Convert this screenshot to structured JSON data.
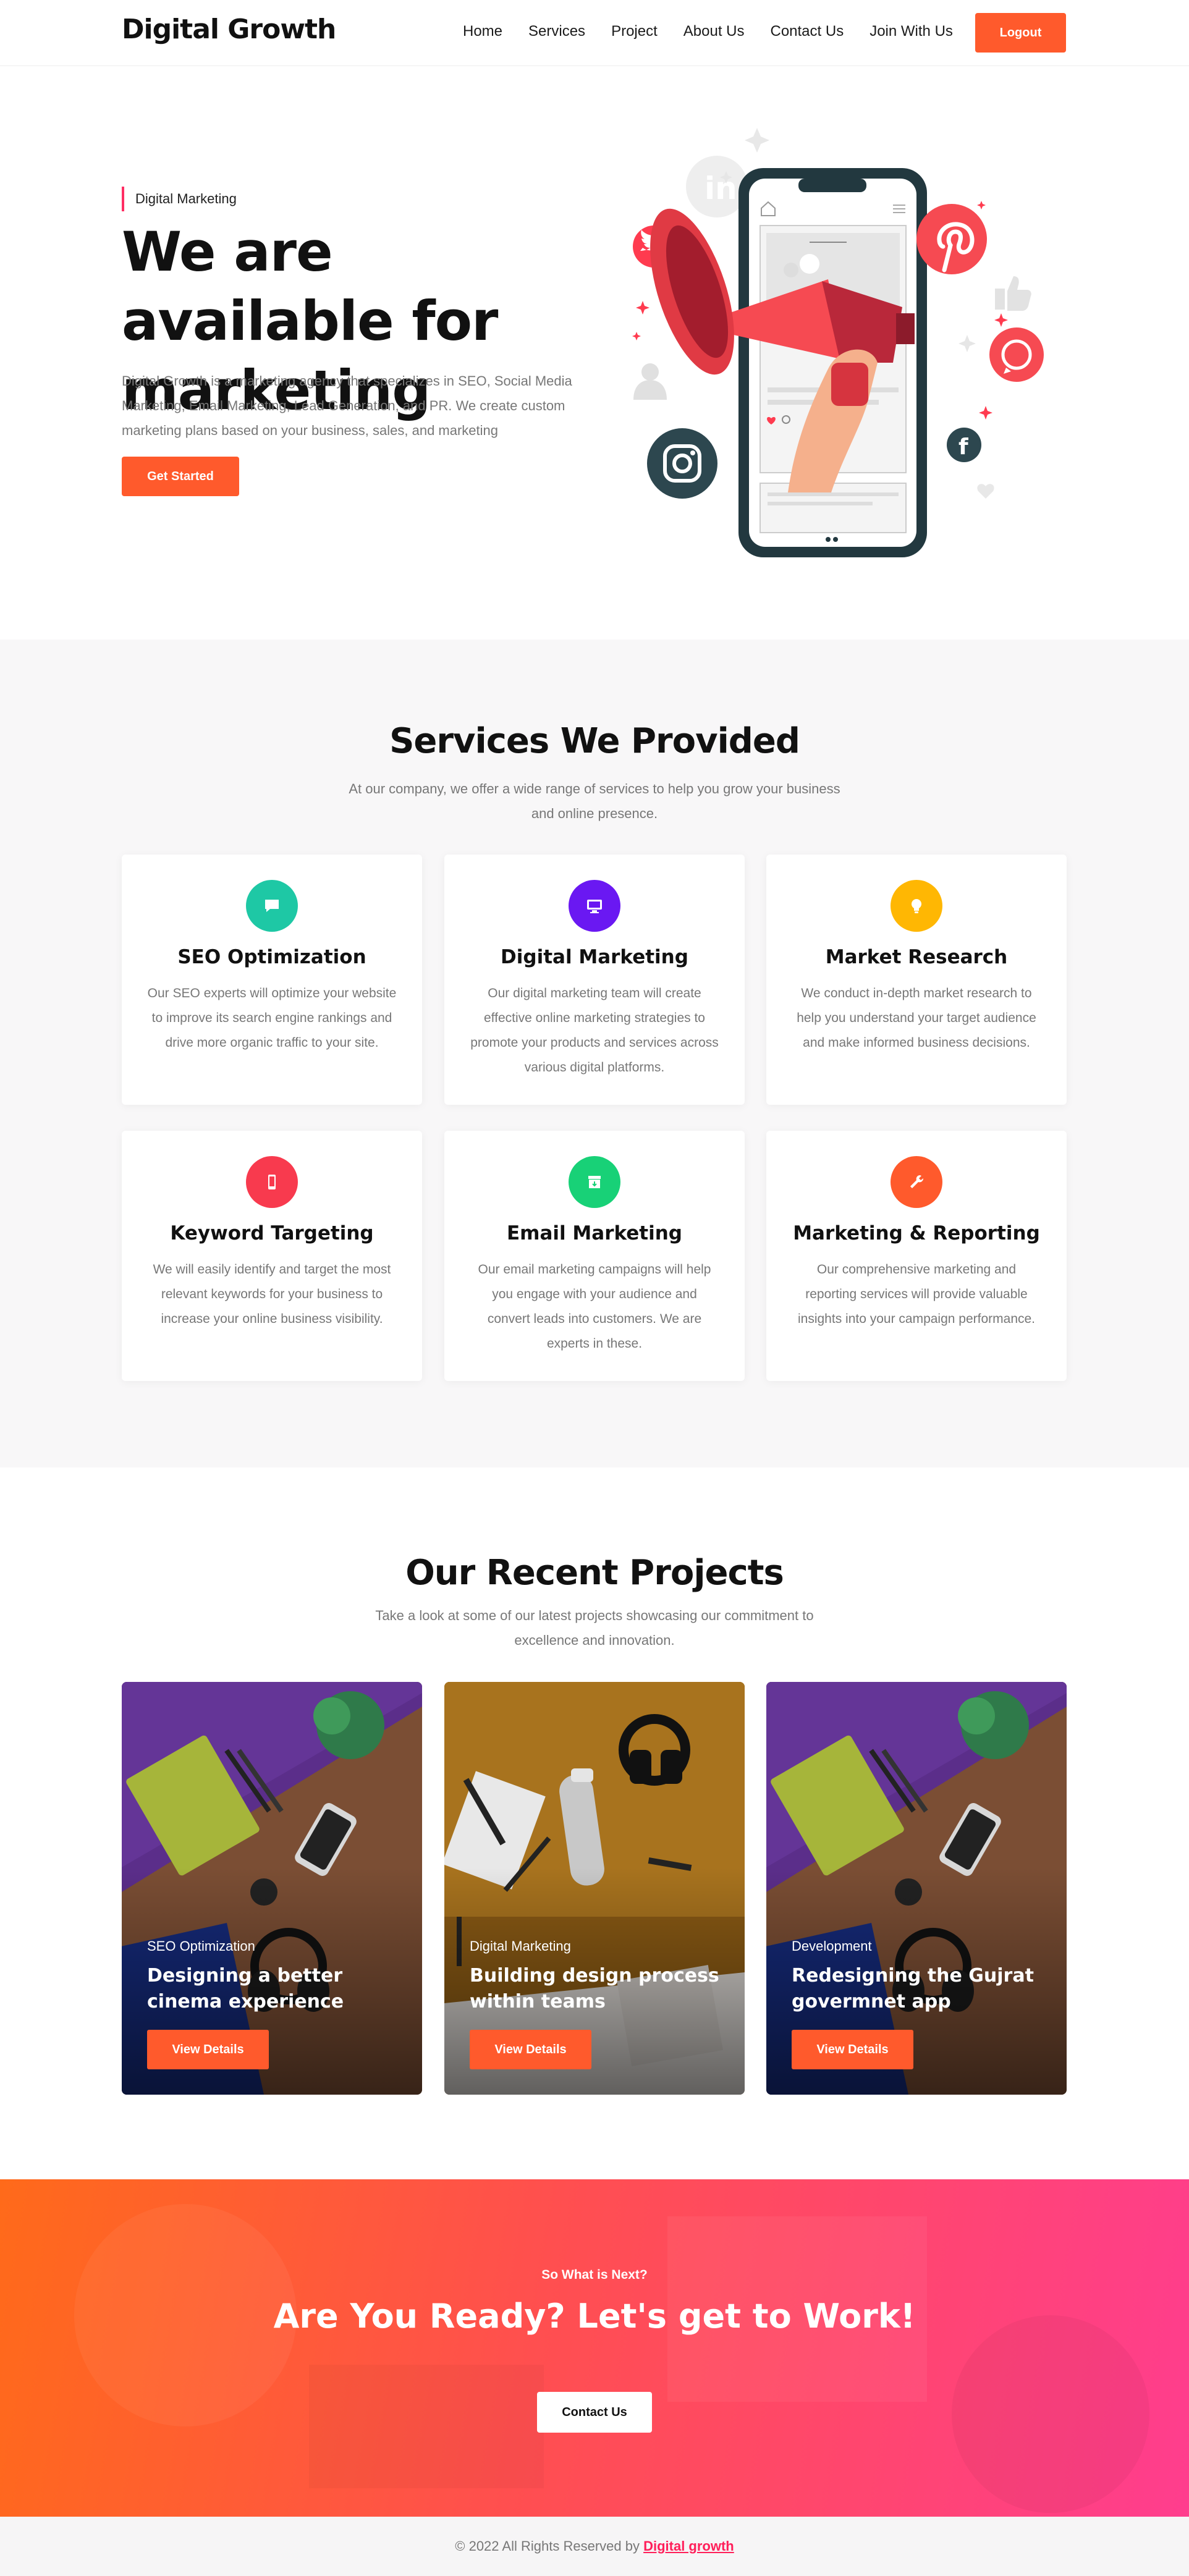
{
  "nav": {
    "brand": "Digital Growth",
    "items": [
      "Home",
      "Services",
      "Project",
      "About Us",
      "Contact Us",
      "Join With Us"
    ],
    "logout_label": "Logout"
  },
  "hero": {
    "eyebrow": "Digital Marketing",
    "title": "We are available for marketing",
    "description": "Digital Growth is a marketing agency that specializes in SEO, Social Media Marketing, Email Marketing, Lead Generation, and PR. We create custom marketing plans based on your business, sales, and marketing",
    "cta_label": "Get Started"
  },
  "services": {
    "title": "Services We Provided",
    "subtitle": "At our company, we offer a wide range of services to help you grow your business and online presence.",
    "cards": [
      {
        "title": "SEO Optimization",
        "text": "Our SEO experts will optimize your website to improve its search engine rankings and drive more organic traffic to your site.",
        "icon": "chat-icon",
        "color": "#1ec8a5"
      },
      {
        "title": "Digital Marketing",
        "text": "Our digital marketing team will create effective online marketing strategies to promote your products and services across various digital platforms.",
        "icon": "monitor-icon",
        "color": "#6a18f2"
      },
      {
        "title": "Market Research",
        "text": "We conduct in-depth market research to help you understand your target audience and make informed business decisions.",
        "icon": "lightbulb-icon",
        "color": "#ffb703"
      },
      {
        "title": "Keyword Targeting",
        "text": "We will easily identify and target the most relevant keywords for your business to increase your online business visibility.",
        "icon": "mobile-icon",
        "color": "#f83a4e"
      },
      {
        "title": "Email Marketing",
        "text": "Our email marketing campaigns will help you engage with your audience and convert leads into customers. We are experts in these.",
        "icon": "archive-icon",
        "color": "#18d177"
      },
      {
        "title": "Marketing & Reporting",
        "text": "Our comprehensive marketing and reporting services will provide valuable insights into your campaign performance.",
        "icon": "wrench-icon",
        "color": "#ff5a2c"
      }
    ]
  },
  "projects": {
    "title": "Our Recent Projects",
    "subtitle": "Take a look at some of our latest projects showcasing our commitment to excellence and innovation.",
    "items": [
      {
        "category": "SEO Optimization",
        "title": "Designing a better cinema experience",
        "button": "View Details"
      },
      {
        "category": "Digital Marketing",
        "title": "Building design process within teams",
        "button": "View Details"
      },
      {
        "category": "Development",
        "title": "Redesigning the Gujrat govermnet app",
        "button": "View Details"
      }
    ]
  },
  "cta": {
    "pretitle": "So What is Next?",
    "title": "Are You Ready? Let's get to Work!",
    "button": "Contact Us"
  },
  "footer": {
    "text": "© 2022 All Rights Reserved by",
    "brand": "Digital growth"
  },
  "colors": {
    "accent": "#ff5a2c",
    "pink": "#ff1f5a",
    "dark": "#111111",
    "muted": "#777777"
  }
}
